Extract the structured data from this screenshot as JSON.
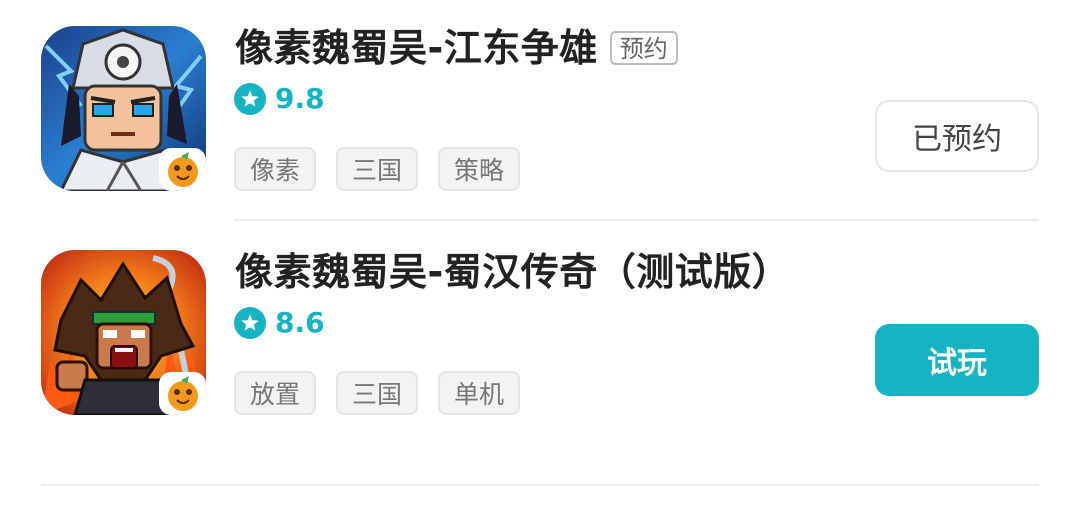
{
  "games": [
    {
      "title": "像素魏蜀吴-江东争雄",
      "badge": "预约",
      "rating": "9.8",
      "tags": [
        "像素",
        "三国",
        "策略"
      ],
      "action_label": "已预约"
    },
    {
      "title": "像素魏蜀吴-蜀汉传奇（测试版）",
      "rating": "8.6",
      "tags": [
        "放置",
        "三国",
        "单机"
      ],
      "action_label": "试玩"
    }
  ],
  "colors": {
    "accent": "#16b3c3",
    "title_text": "#222222",
    "tag_text": "#777777",
    "tag_bg": "#f3f3f3"
  },
  "icons": {
    "rating": "star-icon",
    "store_badge": "orange-icon"
  }
}
